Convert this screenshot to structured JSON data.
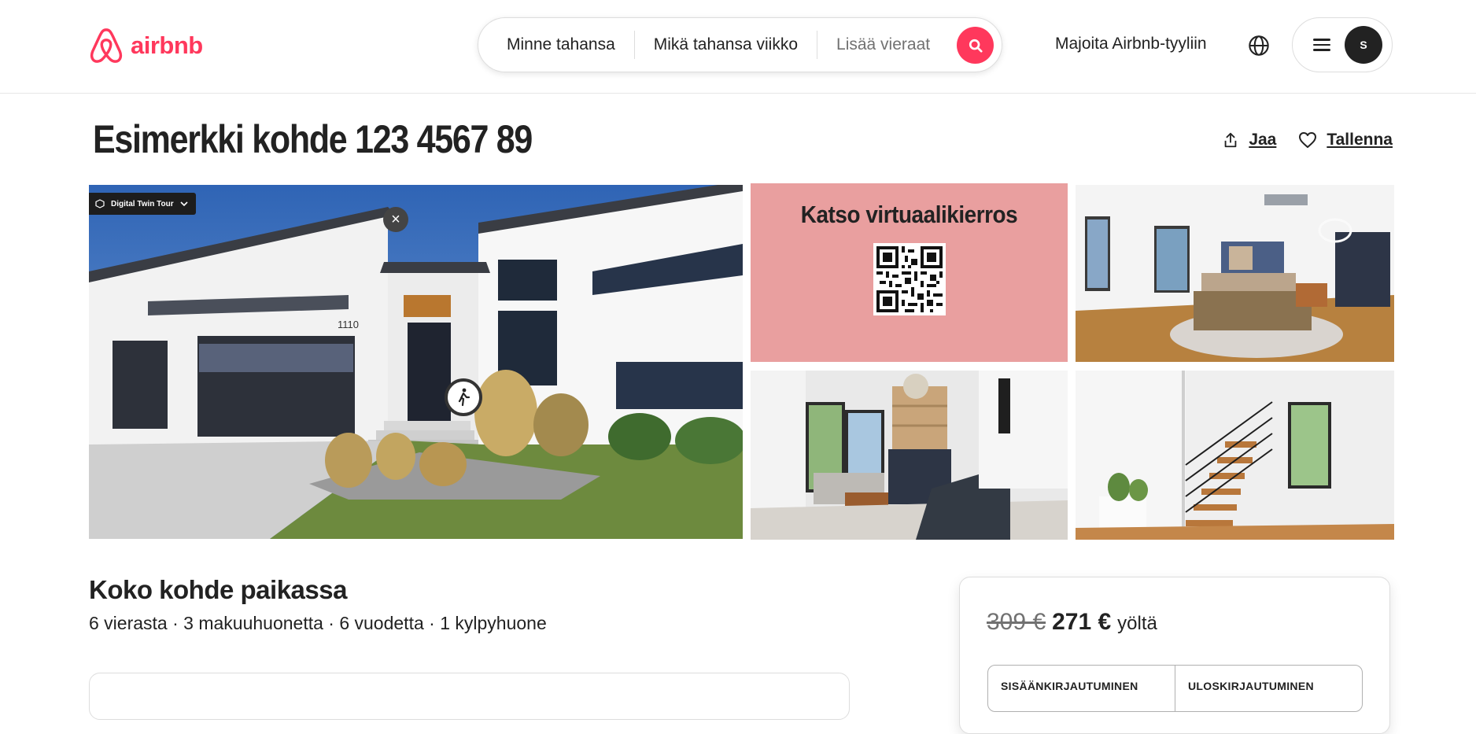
{
  "header": {
    "logo_text": "airbnb",
    "search": {
      "where": "Minne tahansa",
      "when": "Mikä tahansa viikko",
      "guests_placeholder": "Lisää vieraat"
    },
    "host_link": "Majoita Airbnb-tyyliin",
    "avatar_initial": "S"
  },
  "listing": {
    "title": "Esimerkki kohde 123 4567 89",
    "share_label": "Jaa",
    "save_label": "Tallenna"
  },
  "gallery": {
    "tour_chip_label": "Digital Twin Tour",
    "house_number": "1110",
    "virtual_tour_title": "Katso virtuaalikierros"
  },
  "summary": {
    "title": "Koko kohde paikassa",
    "details": "6 vierasta · 3 makuuhuonetta · 6 vuodetta · 1 kylpyhuone"
  },
  "booking": {
    "old_price": "309 €",
    "new_price": "271 €",
    "per_night": "yöltä",
    "checkin_label": "SISÄÄNKIRJAUTUMINEN",
    "checkout_label": "ULOSKIRJAUTUMINEN"
  },
  "colors": {
    "brand": "#ff385c",
    "virtual_tour_bg": "#e99f9f",
    "text": "#222222",
    "muted": "#717171"
  },
  "icons": [
    "airbnb-logo-icon",
    "search-icon",
    "globe-icon",
    "menu-icon",
    "share-icon",
    "heart-icon",
    "cube-icon",
    "chevron-down-icon",
    "close-icon",
    "walker-icon",
    "qr-code-icon"
  ]
}
